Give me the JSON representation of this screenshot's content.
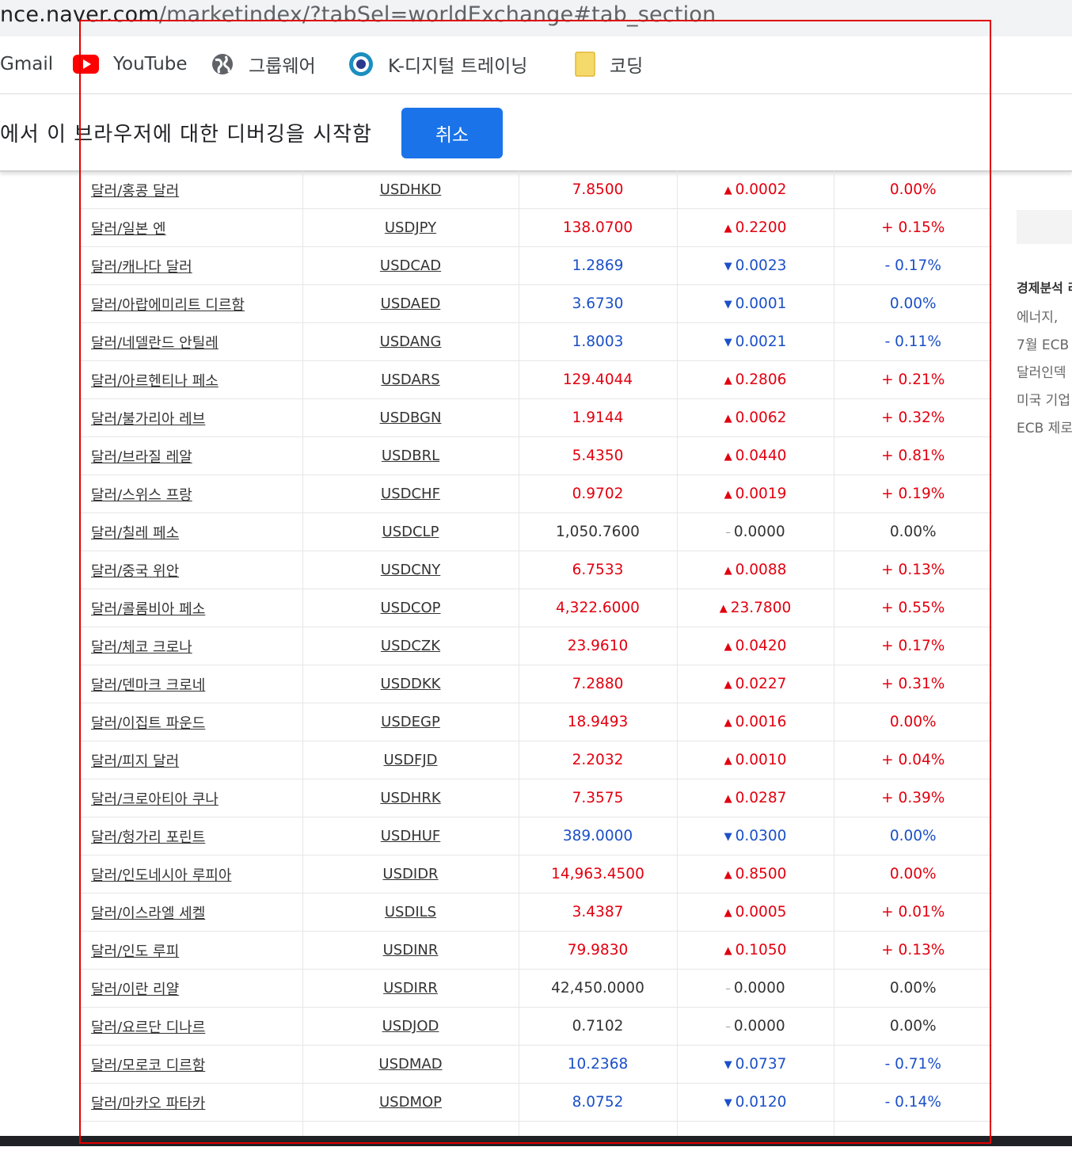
{
  "address_bar": {
    "url_host": "nce.naver.com",
    "url_path": "/marketindex/?tabSel=worldExchange#tab_section"
  },
  "bookmarks": [
    {
      "label": "Gmail",
      "icon": "gmail-icon"
    },
    {
      "label": "YouTube",
      "icon": "youtube-icon"
    },
    {
      "label": "그룹웨어",
      "icon": "globe-icon"
    },
    {
      "label": "K-디지털 트레이닝",
      "icon": "k-digital-icon"
    },
    {
      "label": "코딩",
      "icon": "folder-icon"
    }
  ],
  "infobar": {
    "message": "에서 이 브라우저에 대한 디버깅을 시작함",
    "cancel_label": "취소"
  },
  "colors": {
    "up": "#e2000f",
    "down": "#1b50c8",
    "accent_button": "#1a73e8",
    "selection_frame": "#e00000"
  },
  "rates": [
    {
      "name": "달러/홍콩 달러",
      "symbol": "USDHKD",
      "rate": "7.8500",
      "change": "0.0002",
      "pct": "0.00%",
      "dir": "up"
    },
    {
      "name": "달러/일본 엔",
      "symbol": "USDJPY",
      "rate": "138.0700",
      "change": "0.2200",
      "pct": "+ 0.15%",
      "dir": "up"
    },
    {
      "name": "달러/캐나다 달러",
      "symbol": "USDCAD",
      "rate": "1.2869",
      "change": "0.0023",
      "pct": "- 0.17%",
      "dir": "down"
    },
    {
      "name": "달러/아랍에미리트 디르함",
      "symbol": "USDAED",
      "rate": "3.6730",
      "change": "0.0001",
      "pct": "0.00%",
      "dir": "down"
    },
    {
      "name": "달러/네델란드 안틸레",
      "symbol": "USDANG",
      "rate": "1.8003",
      "change": "0.0021",
      "pct": "- 0.11%",
      "dir": "down"
    },
    {
      "name": "달러/아르헨티나 페소",
      "symbol": "USDARS",
      "rate": "129.4044",
      "change": "0.2806",
      "pct": "+ 0.21%",
      "dir": "up"
    },
    {
      "name": "달러/불가리아 레브",
      "symbol": "USDBGN",
      "rate": "1.9144",
      "change": "0.0062",
      "pct": "+ 0.32%",
      "dir": "up"
    },
    {
      "name": "달러/브라질 레알",
      "symbol": "USDBRL",
      "rate": "5.4350",
      "change": "0.0440",
      "pct": "+ 0.81%",
      "dir": "up"
    },
    {
      "name": "달러/스위스 프랑",
      "symbol": "USDCHF",
      "rate": "0.9702",
      "change": "0.0019",
      "pct": "+ 0.19%",
      "dir": "up"
    },
    {
      "name": "달러/칠레 페소",
      "symbol": "USDCLP",
      "rate": "1,050.7600",
      "change": "0.0000",
      "pct": "0.00%",
      "dir": "flat"
    },
    {
      "name": "달러/중국 위안",
      "symbol": "USDCNY",
      "rate": "6.7533",
      "change": "0.0088",
      "pct": "+ 0.13%",
      "dir": "up"
    },
    {
      "name": "달러/콜롬비아 페소",
      "symbol": "USDCOP",
      "rate": "4,322.6000",
      "change": "23.7800",
      "pct": "+ 0.55%",
      "dir": "up"
    },
    {
      "name": "달러/체코 크로나",
      "symbol": "USDCZK",
      "rate": "23.9610",
      "change": "0.0420",
      "pct": "+ 0.17%",
      "dir": "up"
    },
    {
      "name": "달러/덴마크 크로네",
      "symbol": "USDDKK",
      "rate": "7.2880",
      "change": "0.0227",
      "pct": "+ 0.31%",
      "dir": "up"
    },
    {
      "name": "달러/이집트 파운드",
      "symbol": "USDEGP",
      "rate": "18.9493",
      "change": "0.0016",
      "pct": "0.00%",
      "dir": "up"
    },
    {
      "name": "달러/피지 달러",
      "symbol": "USDFJD",
      "rate": "2.2032",
      "change": "0.0010",
      "pct": "+ 0.04%",
      "dir": "up"
    },
    {
      "name": "달러/크로아티아 쿠나",
      "symbol": "USDHRK",
      "rate": "7.3575",
      "change": "0.0287",
      "pct": "+ 0.39%",
      "dir": "up"
    },
    {
      "name": "달러/헝가리 포린트",
      "symbol": "USDHUF",
      "rate": "389.0000",
      "change": "0.0300",
      "pct": "0.00%",
      "dir": "down"
    },
    {
      "name": "달러/인도네시아 루피아",
      "symbol": "USDIDR",
      "rate": "14,963.4500",
      "change": "0.8500",
      "pct": "0.00%",
      "dir": "up"
    },
    {
      "name": "달러/이스라엘 세켈",
      "symbol": "USDILS",
      "rate": "3.4387",
      "change": "0.0005",
      "pct": "+ 0.01%",
      "dir": "up"
    },
    {
      "name": "달러/인도 루피",
      "symbol": "USDINR",
      "rate": "79.9830",
      "change": "0.1050",
      "pct": "+ 0.13%",
      "dir": "up"
    },
    {
      "name": "달러/이란 리얄",
      "symbol": "USDIRR",
      "rate": "42,450.0000",
      "change": "0.0000",
      "pct": "0.00%",
      "dir": "flat"
    },
    {
      "name": "달러/요르단 디나르",
      "symbol": "USDJOD",
      "rate": "0.7102",
      "change": "0.0000",
      "pct": "0.00%",
      "dir": "flat"
    },
    {
      "name": "달러/모로코 디르함",
      "symbol": "USDMAD",
      "rate": "10.2368",
      "change": "0.0737",
      "pct": "- 0.71%",
      "dir": "down"
    },
    {
      "name": "달러/마카오 파타카",
      "symbol": "USDMOP",
      "rate": "8.0752",
      "change": "0.0120",
      "pct": "- 0.14%",
      "dir": "down"
    }
  ],
  "sidebar": {
    "section_title": "경제분석 리",
    "items": [
      "에너지,",
      "7월 ECB",
      "달러인덱",
      "미국 기업",
      "ECB 제로"
    ]
  }
}
